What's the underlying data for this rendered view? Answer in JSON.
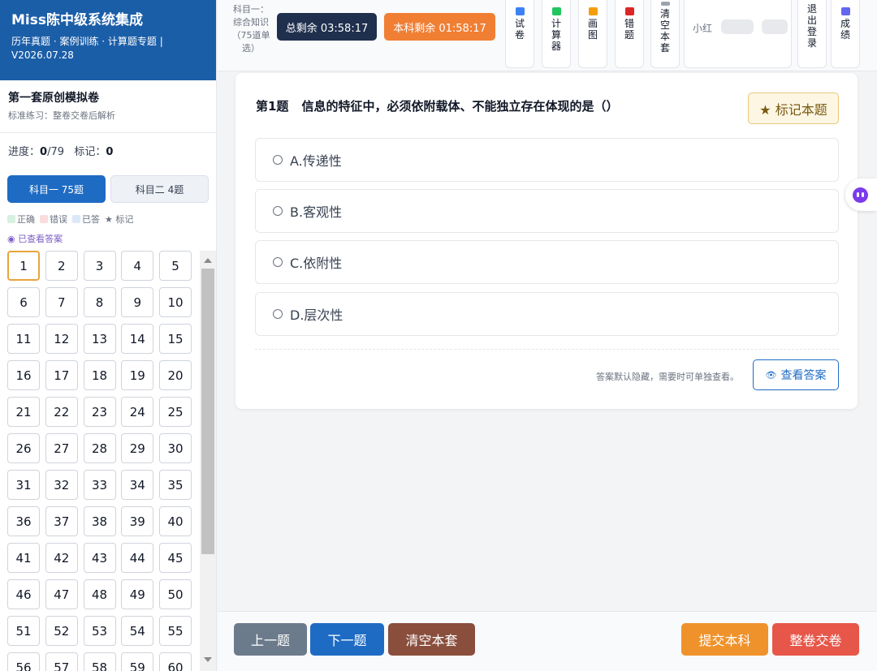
{
  "brand": {
    "title": "Miss陈中级系统集成",
    "subtitle": "历年真题 · 案例训练 · 计算题专题 | V2026.07.28"
  },
  "paper": {
    "title": "第一套原创模拟卷",
    "subtitle": "标准练习：整卷交卷后解析"
  },
  "progress": {
    "label": "进度：",
    "done": "0",
    "total": "/79",
    "mark_label": "标记：",
    "mark_count": "0"
  },
  "subjects": [
    {
      "label": "科目一 75题"
    },
    {
      "label": "科目二 4题"
    }
  ],
  "legend": [
    {
      "label": "正确",
      "color": "#d8f0df"
    },
    {
      "label": "错误",
      "color": "#fbdcdc"
    },
    {
      "label": "已答",
      "color": "#dbe8f8"
    }
  ],
  "legend_star": "★ 标记",
  "viewed_label": "◉ 已查看答案",
  "question_numbers": [
    "1",
    "2",
    "3",
    "4",
    "5",
    "6",
    "7",
    "8",
    "9",
    "10",
    "11",
    "12",
    "13",
    "14",
    "15",
    "16",
    "17",
    "18",
    "19",
    "20",
    "21",
    "22",
    "23",
    "24",
    "25",
    "26",
    "27",
    "28",
    "29",
    "30",
    "31",
    "32",
    "33",
    "34",
    "35",
    "36",
    "37",
    "38",
    "39",
    "40",
    "41",
    "42",
    "43",
    "44",
    "45",
    "46",
    "47",
    "48",
    "49",
    "50",
    "51",
    "52",
    "53",
    "54",
    "55",
    "56",
    "57",
    "58",
    "59",
    "60"
  ],
  "current_question": "1",
  "toolbar": {
    "subject_info": "科目一：综合知识（75道单选）",
    "total_timer": "总剩余 03:58:17",
    "subject_timer": "本科剩余 01:58:17",
    "buttons": [
      {
        "label": "试卷",
        "icon": "exam-icon",
        "color": "#3b82f6"
      },
      {
        "label": "计算器",
        "icon": "calculator-icon",
        "color": "#22c55e"
      },
      {
        "label": "画图",
        "icon": "draw-icon",
        "color": "#f59e0b"
      },
      {
        "label": "错题",
        "icon": "wrong-book-icon",
        "color": "#dc2626"
      },
      {
        "label": "清空本套",
        "icon": "clear-icon",
        "color": "#9ca3af"
      },
      {
        "label": "退出登录",
        "icon": "",
        "color": ""
      },
      {
        "label": "成绩",
        "icon": "score-icon",
        "color": "#6366f1"
      }
    ],
    "user_name": "小红"
  },
  "question": {
    "number": "第1题",
    "text": "信息的特征中，必须依附载体、不能独立存在体现的是（）",
    "mark_button": "★ 标记本题",
    "options": [
      {
        "label": "A.传递性"
      },
      {
        "label": "B.客观性"
      },
      {
        "label": "C.依附性"
      },
      {
        "label": "D.层次性"
      }
    ],
    "hint": "答案默认隐藏，需要时可单独查看。",
    "view_answer": "查看答案",
    "eye_icon": "👁"
  },
  "bottom": {
    "prev": "上一题",
    "next": "下一题",
    "clear": "清空本套",
    "submit_subject": "提交本科",
    "submit_all": "整卷交卷"
  }
}
